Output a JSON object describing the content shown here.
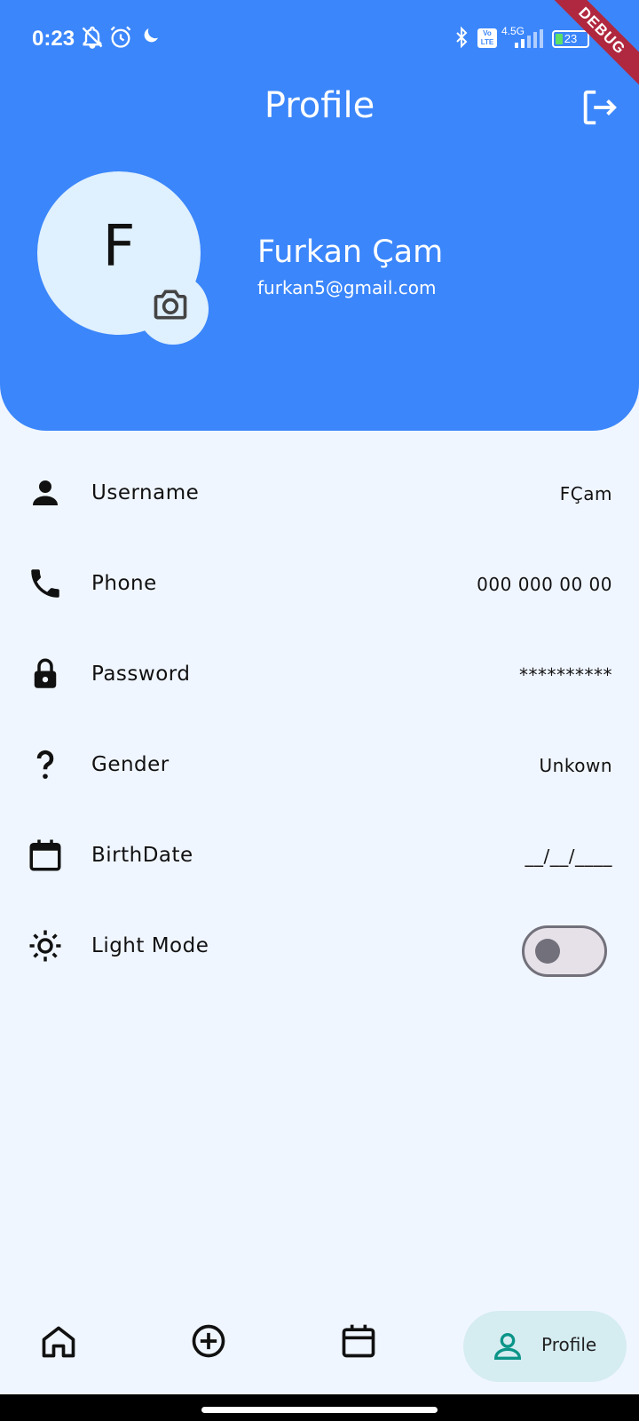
{
  "status_bar": {
    "time": "0:23",
    "network": "4.5G",
    "volte": "Vo LTE",
    "battery": "23",
    "debug_label": "DEBUG",
    "icons": [
      "bell-off-icon",
      "alarm-icon",
      "moon-icon",
      "bluetooth-icon",
      "signal-icon",
      "battery-icon"
    ]
  },
  "header": {
    "title": "Profile",
    "logout_icon": "logout-icon",
    "accent_color": "#3b86fb"
  },
  "profile": {
    "avatar_letter": "F",
    "name": "Furkan Çam",
    "email": "furkan5@gmail.com",
    "camera_icon": "camera-icon"
  },
  "fields": [
    {
      "icon": "person-icon",
      "label": "Username",
      "value": "FÇam"
    },
    {
      "icon": "phone-icon",
      "label": "Phone",
      "value": "000 000 00 00"
    },
    {
      "icon": "lock-icon",
      "label": "Password",
      "value": "**********"
    },
    {
      "icon": "question-icon",
      "label": "Gender",
      "value": "Unkown"
    },
    {
      "icon": "calendar-icon",
      "label": "BirthDate",
      "value": "__/__/____"
    },
    {
      "icon": "sun-icon",
      "label": "Light Mode",
      "toggle_on": false
    }
  ],
  "bottom_nav": {
    "items": [
      {
        "icon": "home-icon"
      },
      {
        "icon": "add-circle-icon"
      },
      {
        "icon": "calendar-icon"
      },
      {
        "icon": "profile-icon",
        "label": "Profile",
        "active": true
      }
    ],
    "active_color": "#d5ecf1"
  }
}
